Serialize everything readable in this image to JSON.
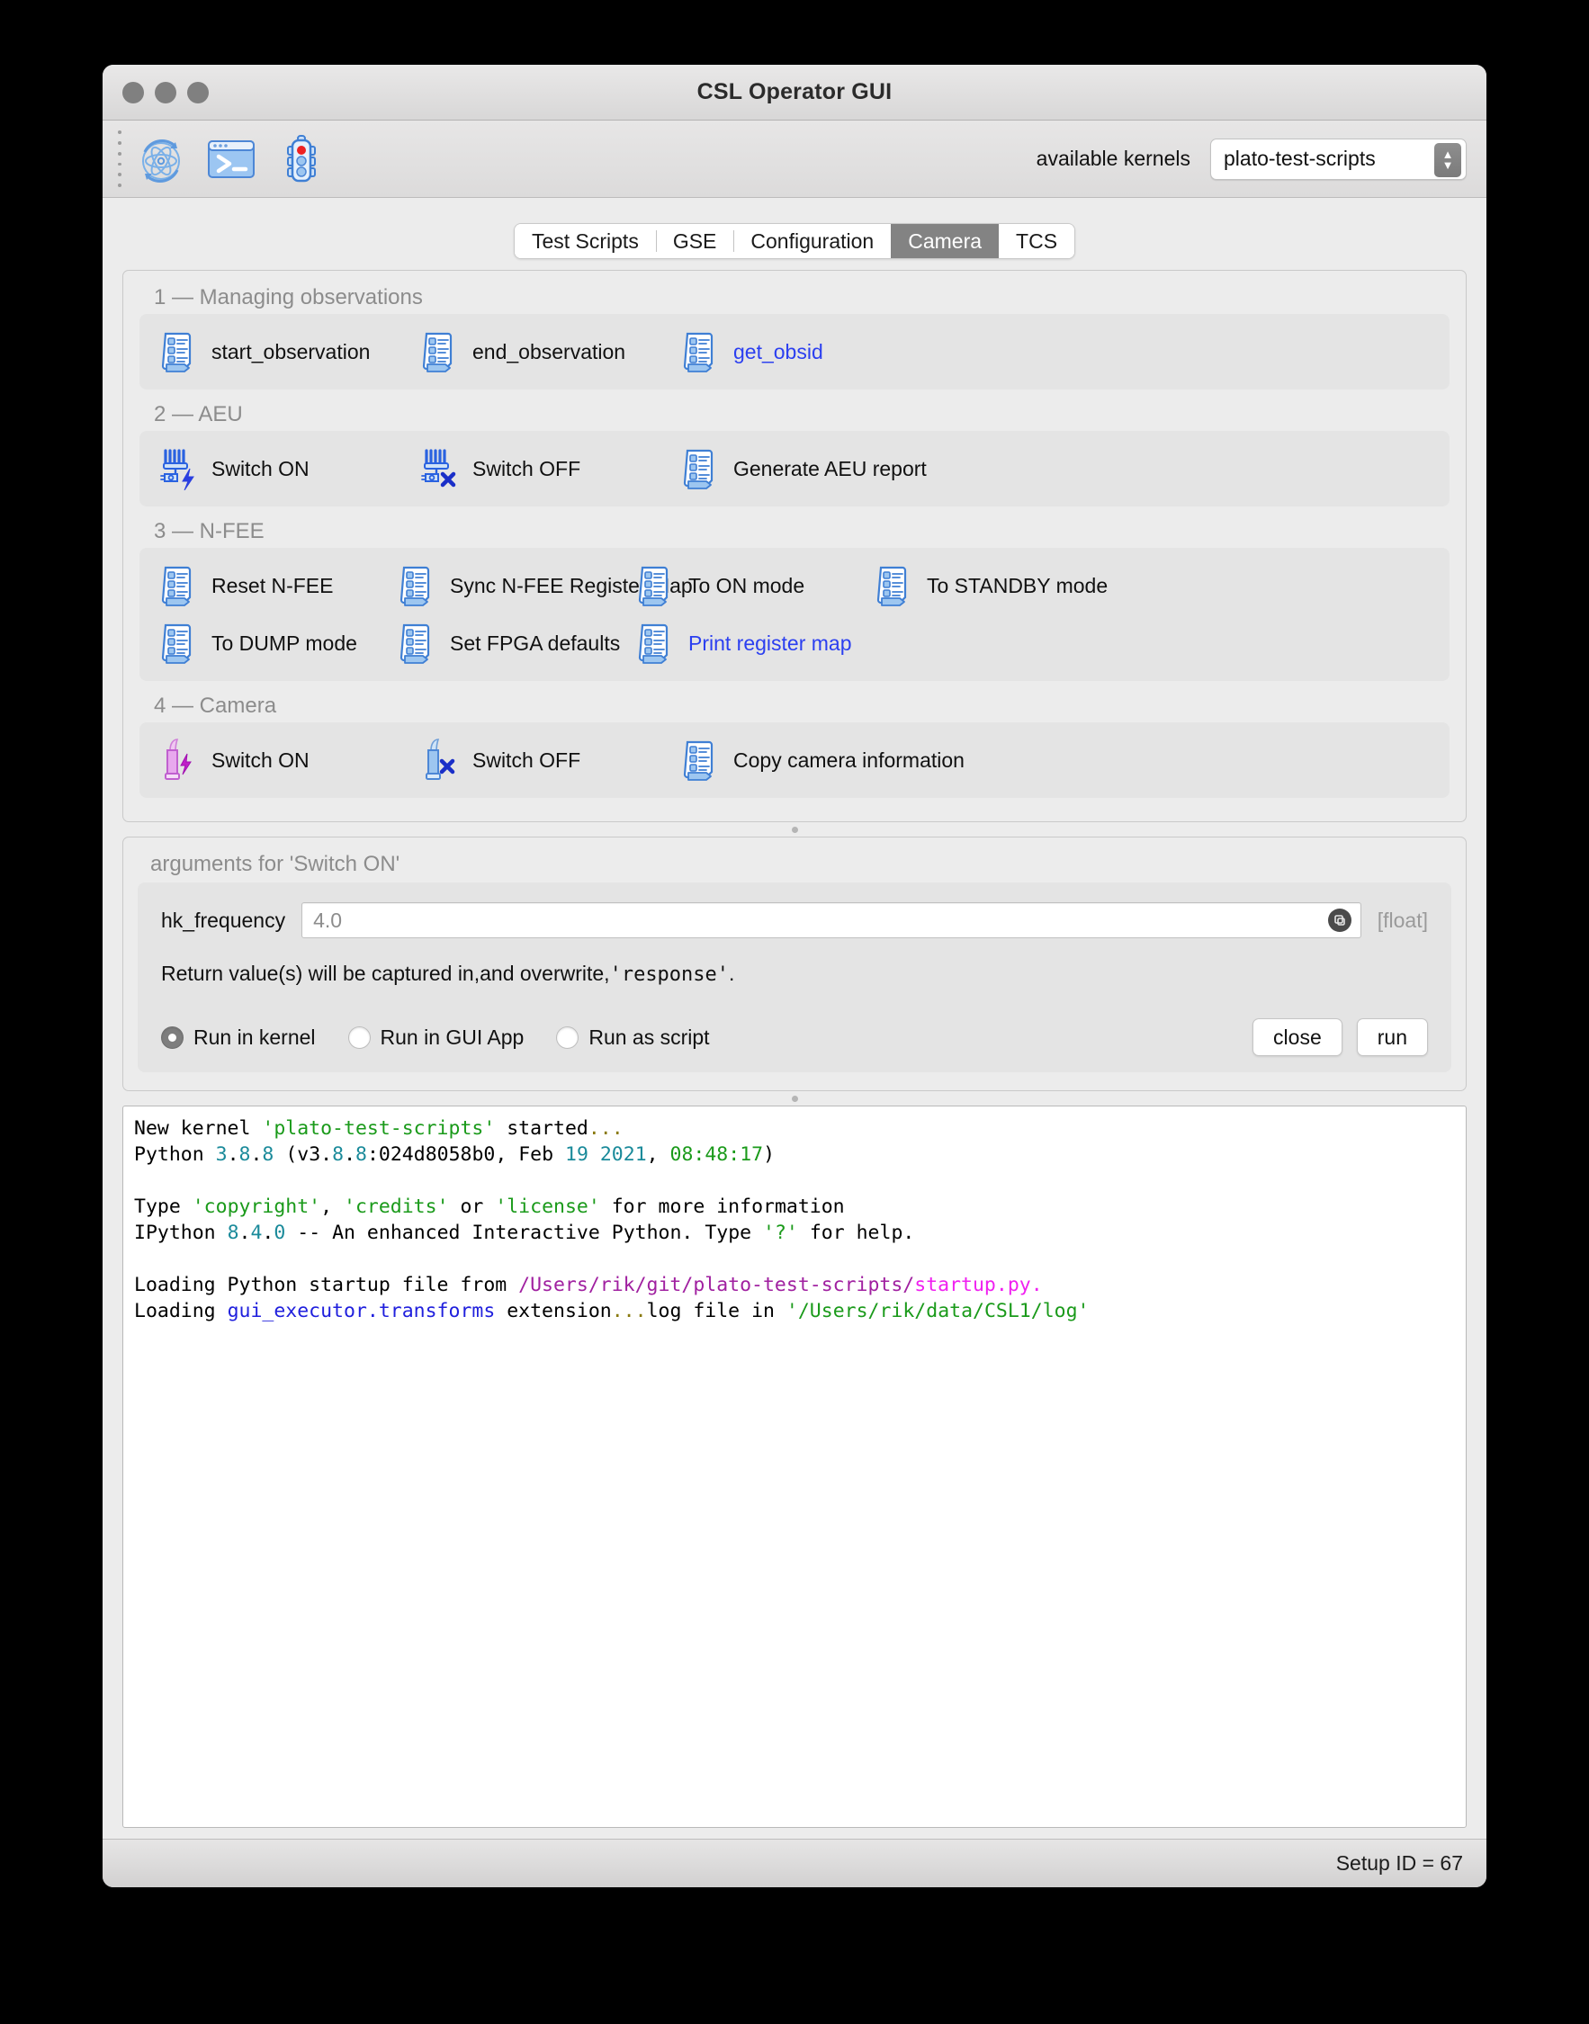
{
  "window": {
    "title": "CSL Operator GUI"
  },
  "toolbar": {
    "icons": [
      {
        "name": "atom-refresh-icon",
        "label": "Reload modules"
      },
      {
        "name": "terminal-icon",
        "label": "Console"
      },
      {
        "name": "traffic-light-icon",
        "label": "Status"
      }
    ],
    "kernel_label": "available kernels",
    "kernel_value": "plato-test-scripts"
  },
  "tabs": [
    {
      "label": "Test Scripts",
      "selected": false
    },
    {
      "label": "GSE",
      "selected": false
    },
    {
      "label": "Configuration",
      "selected": false
    },
    {
      "label": "Camera",
      "selected": true
    },
    {
      "label": "TCS",
      "selected": false
    }
  ],
  "groups": [
    {
      "title": "1 — Managing observations",
      "rows": [
        [
          {
            "label": "start_observation",
            "icon": "script-icon",
            "link": false
          },
          {
            "label": "end_observation",
            "icon": "script-icon",
            "link": false
          },
          {
            "label": "get_obsid",
            "icon": "script-icon",
            "link": true
          }
        ]
      ]
    },
    {
      "title": "2 — AEU",
      "rows": [
        [
          {
            "label": "Switch ON",
            "icon": "power-supply-on-icon",
            "link": false
          },
          {
            "label": "Switch OFF",
            "icon": "power-supply-off-icon",
            "link": false
          },
          {
            "label": "Generate AEU report",
            "icon": "script-icon",
            "link": false
          }
        ]
      ]
    },
    {
      "title": "3 — N-FEE",
      "rows": [
        [
          {
            "label": "Reset N-FEE",
            "icon": "script-icon",
            "link": false
          },
          {
            "label": "Sync N-FEE Register Map",
            "icon": "script-icon",
            "link": false
          },
          {
            "label": "To ON mode",
            "icon": "script-icon",
            "link": false
          },
          {
            "label": "To STANDBY mode",
            "icon": "script-icon",
            "link": false
          }
        ],
        [
          {
            "label": "To DUMP mode",
            "icon": "script-icon",
            "link": false
          },
          {
            "label": "Set FPGA defaults",
            "icon": "script-icon",
            "link": false
          },
          {
            "label": "Print register map",
            "icon": "script-icon",
            "link": true
          }
        ]
      ]
    },
    {
      "title": "4 — Camera",
      "rows": [
        [
          {
            "label": "Switch ON",
            "icon": "camera-on-icon",
            "link": false
          },
          {
            "label": "Switch OFF",
            "icon": "camera-off-icon",
            "link": false
          },
          {
            "label": "Copy camera information",
            "icon": "script-icon",
            "link": false
          }
        ]
      ]
    }
  ],
  "arguments": {
    "title": "arguments for 'Switch ON'",
    "arg_name": "hk_frequency",
    "arg_value": "4.0",
    "arg_placeholder": "4.0",
    "arg_type": "[float]",
    "note_prefix": "Return value(s) will be captured in,and overwrite,",
    "note_mono": "'response'",
    "note_suffix": ".",
    "radios": [
      {
        "label": "Run in kernel",
        "checked": true
      },
      {
        "label": "Run in GUI App",
        "checked": false
      },
      {
        "label": "Run as script",
        "checked": false
      }
    ],
    "close_label": "close",
    "run_label": "run"
  },
  "console": {
    "lines": [
      [
        {
          "t": "New kernel ",
          "c": "plain"
        },
        {
          "t": "'plato-test-scripts'",
          "c": "green"
        },
        {
          "t": " started",
          "c": "plain"
        },
        {
          "t": "...",
          "c": "olive"
        }
      ],
      [
        {
          "t": "Python ",
          "c": "plain"
        },
        {
          "t": "3",
          "c": "teal"
        },
        {
          "t": ".",
          "c": "plain"
        },
        {
          "t": "8",
          "c": "teal"
        },
        {
          "t": ".",
          "c": "plain"
        },
        {
          "t": "8",
          "c": "teal"
        },
        {
          "t": " (v3.",
          "c": "plain"
        },
        {
          "t": "8",
          "c": "teal"
        },
        {
          "t": ".",
          "c": "plain"
        },
        {
          "t": "8",
          "c": "teal"
        },
        {
          "t": ":024d8058b0, Feb ",
          "c": "plain"
        },
        {
          "t": "19 2021",
          "c": "teal"
        },
        {
          "t": ", ",
          "c": "plain"
        },
        {
          "t": "08:48:17",
          "c": "green"
        },
        {
          "t": ")",
          "c": "plain"
        }
      ],
      [],
      [
        {
          "t": "Type ",
          "c": "plain"
        },
        {
          "t": "'copyright'",
          "c": "green"
        },
        {
          "t": ", ",
          "c": "plain"
        },
        {
          "t": "'credits'",
          "c": "green"
        },
        {
          "t": " or ",
          "c": "plain"
        },
        {
          "t": "'license'",
          "c": "green"
        },
        {
          "t": " for more information",
          "c": "plain"
        }
      ],
      [
        {
          "t": "IPython ",
          "c": "plain"
        },
        {
          "t": "8",
          "c": "teal"
        },
        {
          "t": ".",
          "c": "plain"
        },
        {
          "t": "4",
          "c": "teal"
        },
        {
          "t": ".",
          "c": "plain"
        },
        {
          "t": "0",
          "c": "teal"
        },
        {
          "t": " -- An enhanced Interactive Python. Type ",
          "c": "plain"
        },
        {
          "t": "'?'",
          "c": "green"
        },
        {
          "t": " for help.",
          "c": "plain"
        }
      ],
      [],
      [
        {
          "t": "Loading Python startup file from ",
          "c": "plain"
        },
        {
          "t": "/Users/rik/git/plato-test-scripts/",
          "c": "purple"
        },
        {
          "t": "startup.py.",
          "c": "magenta"
        }
      ],
      [
        {
          "t": "Loading ",
          "c": "plain"
        },
        {
          "t": "gui_executor.transforms",
          "c": "blue"
        },
        {
          "t": " extension",
          "c": "plain"
        },
        {
          "t": "...",
          "c": "olive"
        },
        {
          "t": "log file in ",
          "c": "plain"
        },
        {
          "t": "'/Users/rik/data/CSL1/log'",
          "c": "green"
        }
      ]
    ]
  },
  "statusbar": {
    "setup_id": "Setup ID = 67"
  }
}
